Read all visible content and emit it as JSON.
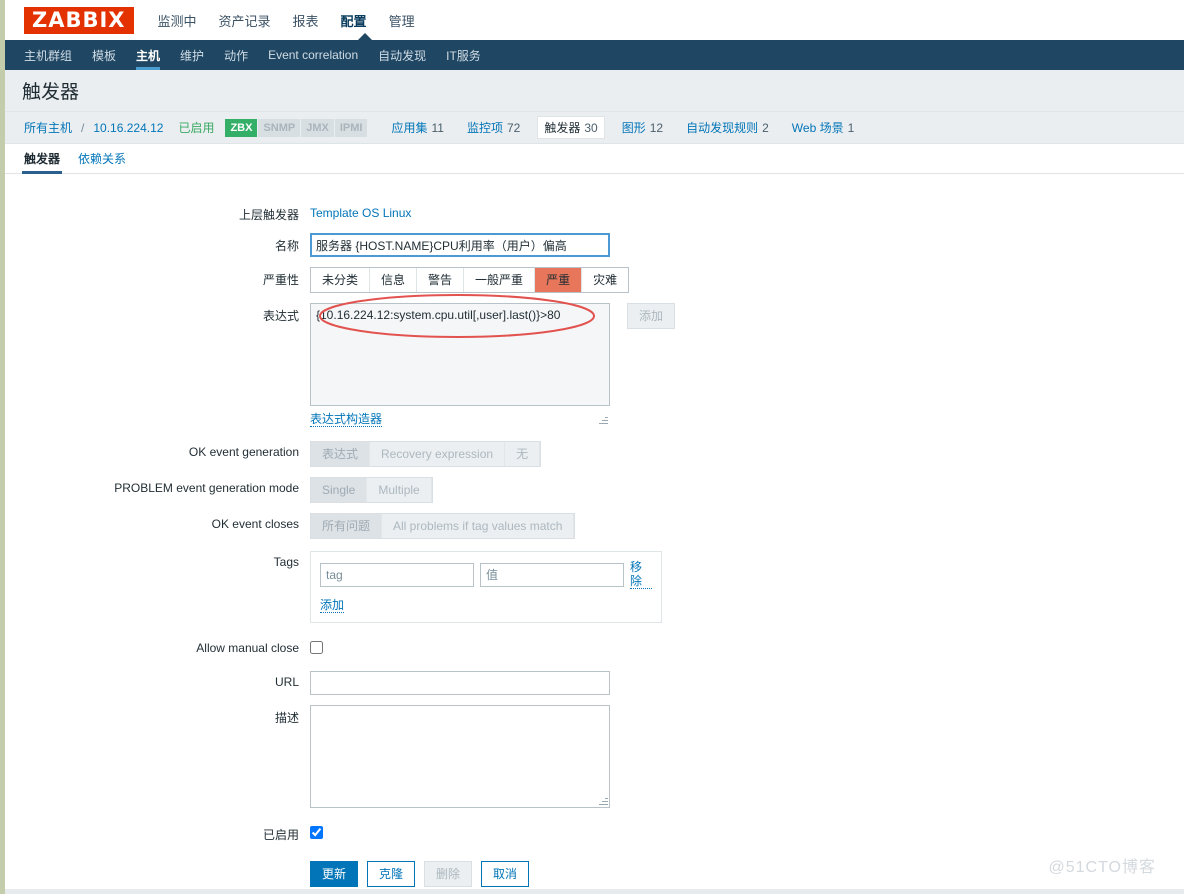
{
  "brand": {
    "logo_text": "ZABBIX",
    "logo_bg": "#e33200"
  },
  "topnav": {
    "items": [
      {
        "label": "监测中",
        "active": false
      },
      {
        "label": "资产记录",
        "active": false
      },
      {
        "label": "报表",
        "active": false
      },
      {
        "label": "配置",
        "active": true
      },
      {
        "label": "管理",
        "active": false
      }
    ]
  },
  "subnav": {
    "items": [
      {
        "label": "主机群组",
        "active": false
      },
      {
        "label": "模板",
        "active": false
      },
      {
        "label": "主机",
        "active": true
      },
      {
        "label": "维护",
        "active": false
      },
      {
        "label": "动作",
        "active": false
      },
      {
        "label": "Event correlation",
        "active": false
      },
      {
        "label": "自动发现",
        "active": false
      },
      {
        "label": "IT服务",
        "active": false
      }
    ]
  },
  "page": {
    "title": "触发器"
  },
  "breadcrumb": {
    "all_hosts": "所有主机",
    "separator": "/",
    "host": "10.16.224.12",
    "status": "已启用",
    "badges": [
      {
        "label": "ZBX",
        "enabled": true
      },
      {
        "label": "SNMP",
        "enabled": false
      },
      {
        "label": "JMX",
        "enabled": false
      },
      {
        "label": "IPMI",
        "enabled": false
      }
    ],
    "entries": [
      {
        "label": "应用集",
        "count": "11",
        "current": false
      },
      {
        "label": "监控项",
        "count": "72",
        "current": false
      },
      {
        "label": "触发器",
        "count": "30",
        "current": true
      },
      {
        "label": "图形",
        "count": "12",
        "current": false
      },
      {
        "label": "自动发现规则",
        "count": "2",
        "current": false
      },
      {
        "label": "Web 场景",
        "count": "1",
        "current": false
      }
    ]
  },
  "tabs": [
    {
      "label": "触发器",
      "active": true
    },
    {
      "label": "依赖关系",
      "active": false
    }
  ],
  "form": {
    "parent_trigger": {
      "label": "上层触发器",
      "value": "Template OS Linux"
    },
    "name": {
      "label": "名称",
      "value": "服务器 {HOST.NAME}CPU利用率（用户）偏高",
      "placeholder": ""
    },
    "severity": {
      "label": "严重性",
      "options": [
        "未分类",
        "信息",
        "警告",
        "一般严重",
        "严重",
        "灾难"
      ],
      "selected": "严重",
      "selected_color": "#e8765a"
    },
    "expression": {
      "label": "表达式",
      "value": "{10.16.224.12:system.cpu.util[,user].last()}>80",
      "add_button": "添加",
      "constructor_link": "表达式构造器"
    },
    "ok_event_generation": {
      "label": "OK event generation",
      "options": [
        "表达式",
        "Recovery expression",
        "无"
      ],
      "selected": "表达式"
    },
    "problem_event_generation_mode": {
      "label": "PROBLEM event generation mode",
      "options": [
        "Single",
        "Multiple"
      ],
      "selected": "Single"
    },
    "ok_event_closes": {
      "label": "OK event closes",
      "options": [
        "所有问题",
        "All problems if tag values match"
      ],
      "selected": "所有问题"
    },
    "tags": {
      "label": "Tags",
      "tag_placeholder": "tag",
      "tag_value": "",
      "value_placeholder": "值",
      "value_value": "",
      "remove_label": "移除",
      "add_label": "添加"
    },
    "allow_manual_close": {
      "label": "Allow manual close",
      "checked": false
    },
    "url": {
      "label": "URL",
      "value": "",
      "placeholder": ""
    },
    "description": {
      "label": "描述",
      "value": "",
      "placeholder": ""
    },
    "enabled": {
      "label": "已启用",
      "checked": true
    }
  },
  "actions": {
    "update": "更新",
    "clone": "克隆",
    "delete": "删除",
    "cancel": "取消"
  },
  "watermark": {
    "text": "@51CTO博客"
  }
}
